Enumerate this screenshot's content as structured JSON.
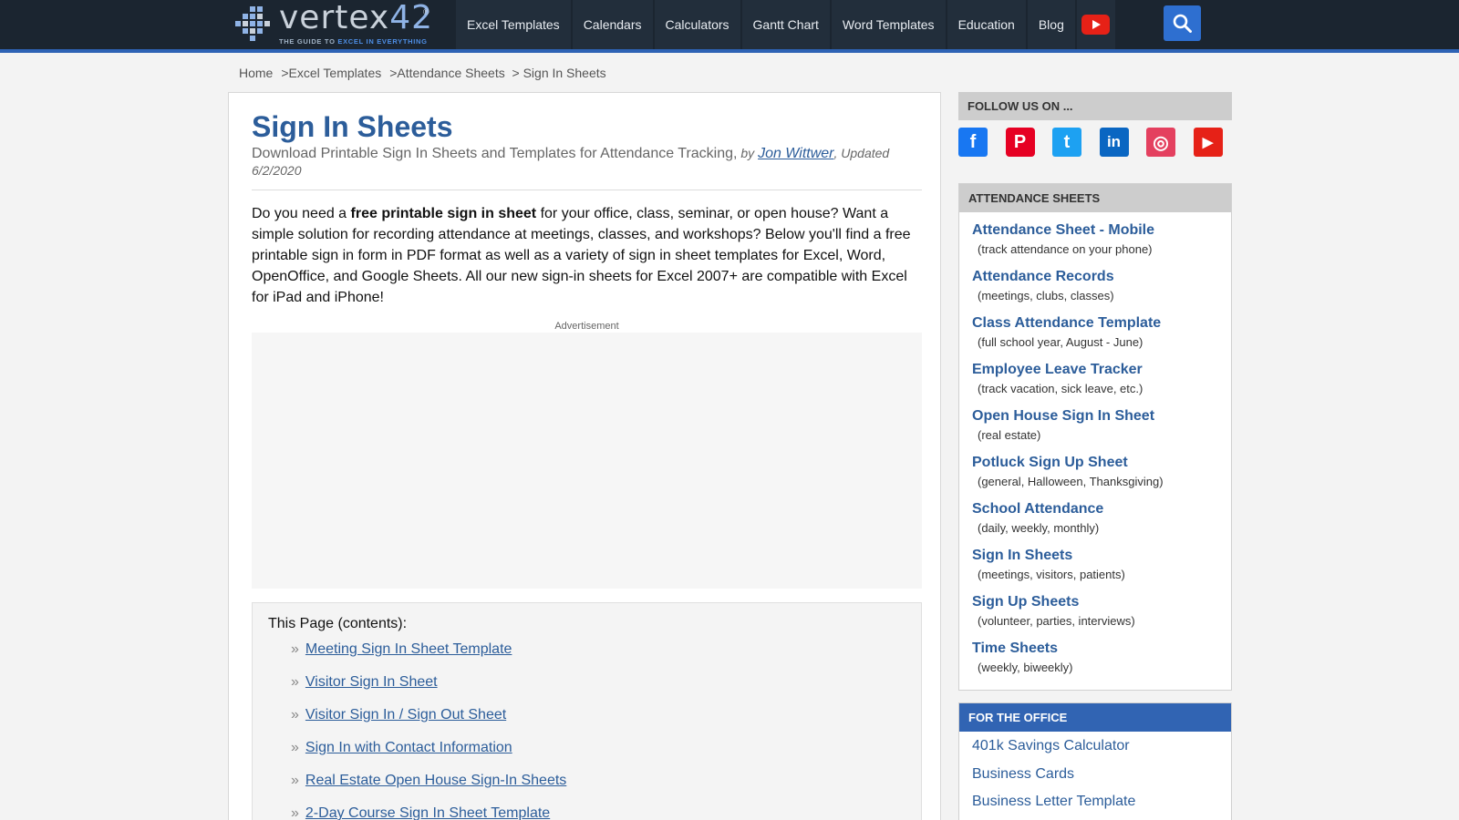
{
  "header": {
    "logo_text_a": "vertex",
    "logo_text_b": "42",
    "logo_reg": "®",
    "tagline_a": "THE GUIDE TO ",
    "tagline_b": "EXCEL IN EVERYTHING",
    "nav": [
      "Excel Templates",
      "Calendars",
      "Calculators",
      "Gantt Chart",
      "Word Templates",
      "Education",
      "Blog"
    ]
  },
  "breadcrumb": {
    "home": "Home",
    "excel": "Excel Templates",
    "attendance": "Attendance Sheets",
    "current": "> Sign In Sheets",
    "sep": ">"
  },
  "main": {
    "title": "Sign In Sheets",
    "subtitle": "Download Printable Sign In Sheets and Templates for Attendance Tracking,",
    "by": " by ",
    "author": "Jon Wittwer",
    "updated": ", Updated 6/2/2020",
    "intro_1": "Do you need a ",
    "intro_bold": "free printable sign in sheet",
    "intro_2": " for your office, class, seminar, or open house? Want a simple solution for recording attendance at meetings, classes, and workshops? Below you'll find a free printable sign in form in PDF format as well as a variety of sign in sheet templates for Excel, Word, OpenOffice, and Google Sheets. All our new sign-in sheets for Excel 2007+ are compatible with Excel for iPad and iPhone!",
    "ad_label": "Advertisement",
    "toc_title": "This Page (contents):",
    "toc_marker": "»",
    "toc": [
      "Meeting Sign In Sheet Template",
      "Visitor Sign In Sheet",
      "Visitor Sign In / Sign Out Sheet",
      "Sign In with Contact Information",
      "Real Estate Open House Sign-In Sheets",
      "2-Day Course Sign In Sheet Template"
    ]
  },
  "sidebar": {
    "follow_title": "FOLLOW US ON ...",
    "social": {
      "facebook": "f",
      "pinterest": "P",
      "twitter": "t",
      "linkedin": "in",
      "instagram": "◎",
      "youtube": "▶"
    },
    "attendance_title": "ATTENDANCE SHEETS",
    "attendance": [
      {
        "title": "Attendance Sheet - Mobile",
        "desc": "(track attendance on your phone)"
      },
      {
        "title": "Attendance Records",
        "desc": "(meetings, clubs, classes)"
      },
      {
        "title": "Class Attendance Template",
        "desc": "(full school year, August - June)"
      },
      {
        "title": "Employee Leave Tracker",
        "desc": "(track vacation, sick leave, etc.)"
      },
      {
        "title": "Open House Sign In Sheet",
        "desc": "(real estate)"
      },
      {
        "title": "Potluck Sign Up Sheet",
        "desc": "(general, Halloween, Thanksgiving)"
      },
      {
        "title": "School Attendance",
        "desc": "(daily, weekly, monthly)"
      },
      {
        "title": "Sign In Sheets",
        "desc": "(meetings, visitors, patients)"
      },
      {
        "title": "Sign Up Sheets",
        "desc": "(volunteer, parties, interviews)"
      },
      {
        "title": "Time Sheets",
        "desc": "(weekly, biweekly)"
      }
    ],
    "office_title": "FOR THE OFFICE",
    "office": [
      "401k Savings Calculator",
      "Business Cards",
      "Business Letter Template"
    ]
  },
  "colors": {
    "header_bg": "#1b2530",
    "accent_blue": "#2e63b5",
    "link": "#2c5d9a"
  }
}
